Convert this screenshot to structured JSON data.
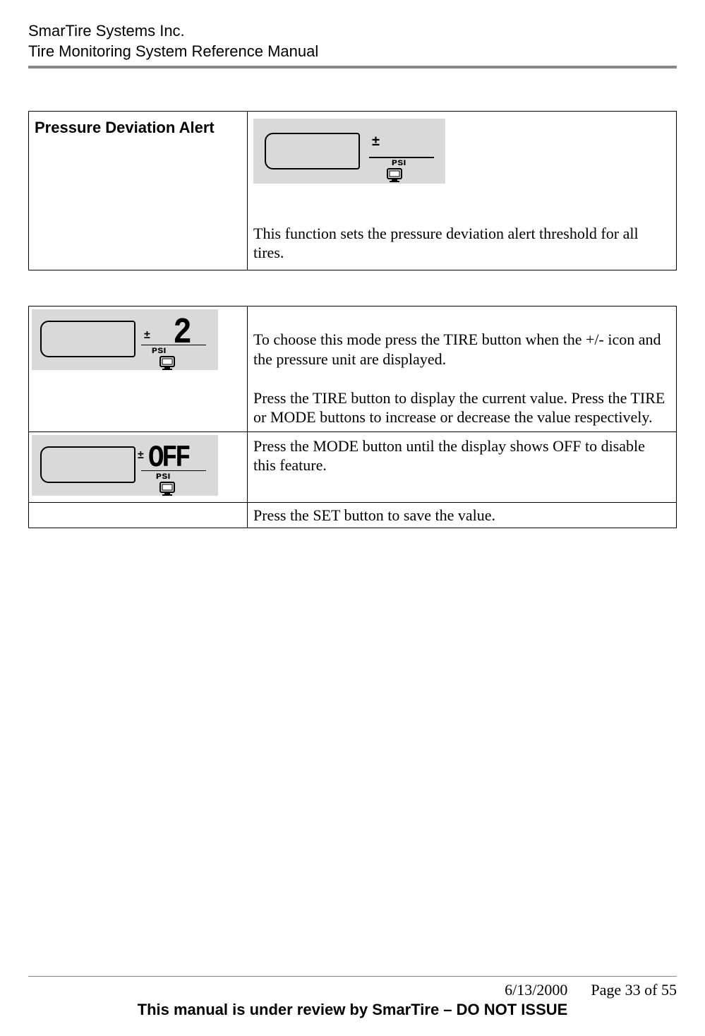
{
  "header": {
    "company": "SmarTire Systems Inc.",
    "subtitle": "Tire Monitoring System Reference Manual"
  },
  "section1": {
    "title": "Pressure Deviation Alert",
    "lcd1": {
      "plus_minus": "±",
      "psi": "PSI"
    },
    "desc": "This function sets the pressure deviation alert threshold for all tires."
  },
  "section2": {
    "row1": {
      "lcd": {
        "plus_minus": "±",
        "psi": "PSI",
        "value": "2"
      },
      "text": "To choose this mode press the TIRE button when the +/- icon and the pressure unit are displayed.\n\nPress the TIRE button to display the current value. Press the TIRE or  MODE buttons to increase or decrease the value respectively."
    },
    "row2": {
      "lcd": {
        "plus_minus": "±",
        "psi": "PSI",
        "value": "OFF"
      },
      "text": "Press the MODE button until the display shows OFF to disable this feature."
    },
    "row3": {
      "text": "Press the SET button to save the value."
    }
  },
  "footer": {
    "date": "6/13/2000",
    "page": "Page 33 of 55",
    "note": "This manual is under review by SmarTire – DO NOT ISSUE"
  }
}
